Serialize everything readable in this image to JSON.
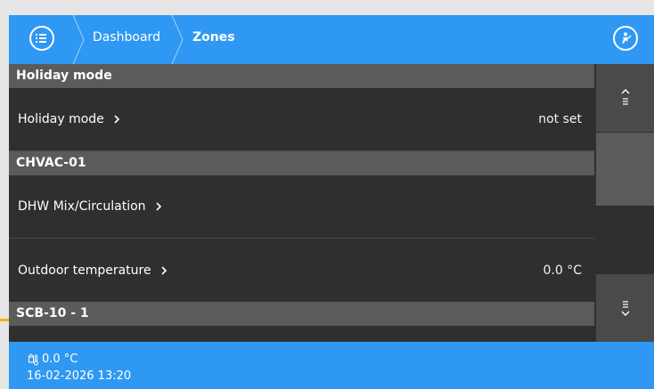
{
  "header": {
    "breadcrumbs": [
      {
        "label": "Dashboard"
      },
      {
        "label": "Zones"
      }
    ]
  },
  "sections": [
    {
      "title": "Holiday mode",
      "rows": [
        {
          "label": "Holiday mode",
          "value": "not set"
        }
      ]
    },
    {
      "title": "CHVAC-01",
      "rows": [
        {
          "label": "DHW Mix/Circulation",
          "value": ""
        },
        {
          "label": "Outdoor temperature",
          "value": "0.0 °C"
        }
      ]
    },
    {
      "title": "SCB-10 - 1",
      "rows": []
    }
  ],
  "footer": {
    "temperature": "0.0 °C",
    "datetime": "16-02-2026 13:20"
  },
  "colors": {
    "accent": "#2f98f2",
    "section_bg": "#5b5b5b",
    "row_bg": "#2f2f2f"
  }
}
